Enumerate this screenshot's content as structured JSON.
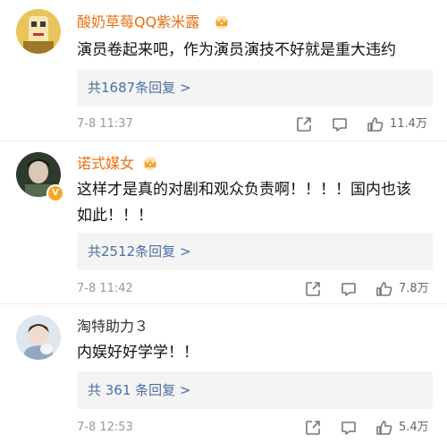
{
  "comments": [
    {
      "username": "酸奶草莓QQ紫米露",
      "content": "演员卷起来吧，作为演员演技不好就是重大违约",
      "replies": "共1687条回复 >",
      "time": "7-8 11:37",
      "likes": "11.4万",
      "vip_badge": true,
      "avatar_icon": "yellow-illustration-avatar"
    },
    {
      "username": "诺式媒女",
      "content": "这样才是真的对剧和观众负责啊！！！！国内也该如此！！！",
      "replies": "共2512条回复 >",
      "time": "7-8 11:42",
      "likes": "7.8万",
      "vip_badge": true,
      "verified_badge": "V",
      "avatar_icon": "dark-photo-avatar"
    },
    {
      "username": "淘特助力３",
      "content": "内娱好好学学！！",
      "replies": "共 361 条回复 >",
      "time": "7-8 12:53",
      "likes": "5.4万",
      "vip_badge": false,
      "avatar_icon": "girl-with-cat-avatar"
    }
  ],
  "icons": {
    "share": "share-icon",
    "comment": "comment-icon",
    "like": "thumbs-up-icon",
    "crown": "crown-badge-icon"
  },
  "colors": {
    "vip_name": "#e8700f",
    "reply_link": "#4a6fa5",
    "meta_text": "#999999",
    "badge": "#f5a623"
  }
}
